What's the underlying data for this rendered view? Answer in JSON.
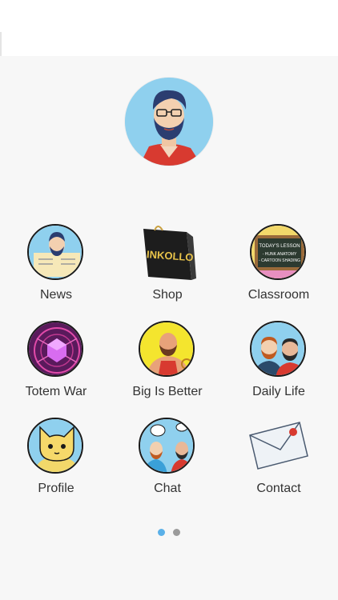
{
  "colors": {
    "background": "#f7f7f7",
    "dot_active": "#5ab0e8",
    "dot_inactive": "#9b9b9b"
  },
  "header": {
    "avatar_icon": "bearded-man-avatar-icon"
  },
  "menu": [
    {
      "label": "News",
      "icon": "newspaper-man-icon"
    },
    {
      "label": "Shop",
      "icon": "shopping-bag-icon"
    },
    {
      "label": "Classroom",
      "icon": "chalkboard-icon"
    },
    {
      "label": "Totem War",
      "icon": "crystal-icon"
    },
    {
      "label": "Big Is Better",
      "icon": "muscle-man-icon"
    },
    {
      "label": "Daily Life",
      "icon": "couple-icon"
    },
    {
      "label": "Profile",
      "icon": "cat-icon"
    },
    {
      "label": "Chat",
      "icon": "chat-bubbles-icon"
    },
    {
      "label": "Contact",
      "icon": "envelope-icon"
    }
  ],
  "shop_bag_text": "INKOLLO",
  "classroom_board": {
    "title": "TODAY'S LESSON",
    "line1": "- HUNK ANATOMY",
    "line2": "- CARTOON SHADING"
  },
  "pager": {
    "page_count": 2,
    "active_page": 1
  }
}
